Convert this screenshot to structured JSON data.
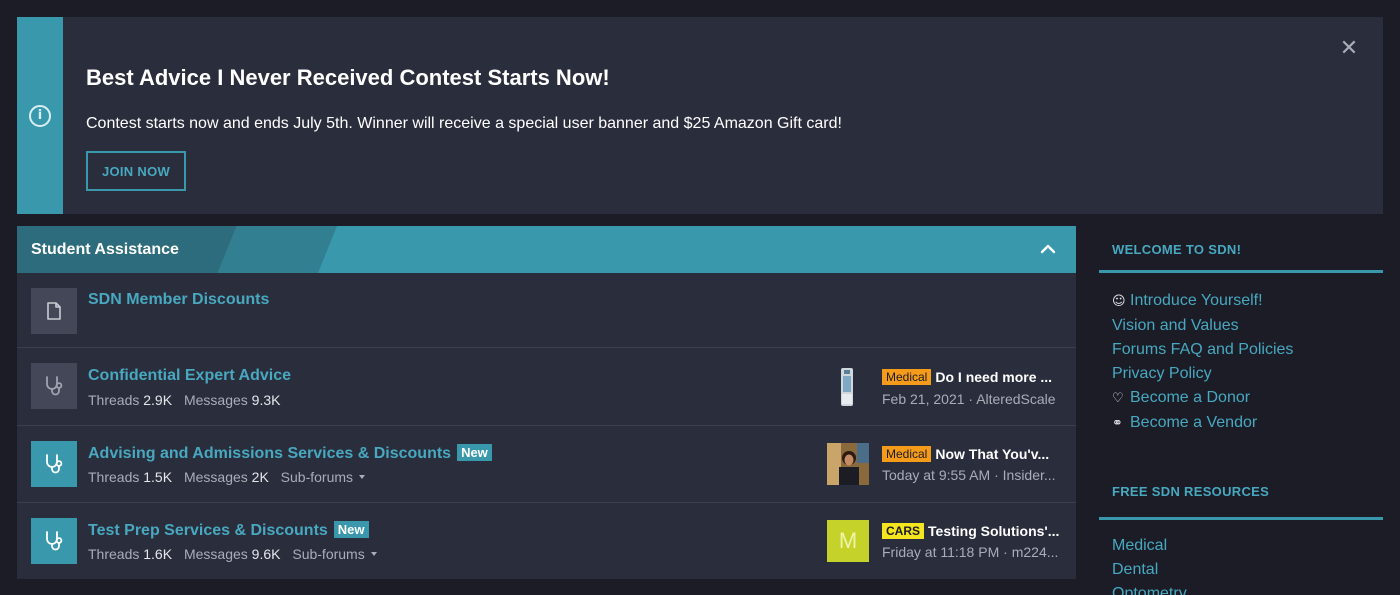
{
  "notice": {
    "title": "Best Advice I Never Received Contest Starts Now!",
    "text": "Contest starts now and ends July 5th. Winner will receive a special user banner and $25 Amazon Gift card!",
    "button": "JOIN NOW",
    "info_icon": "info-icon",
    "close_icon": "close-icon"
  },
  "forum": {
    "category": "Student Assistance",
    "nodes": [
      {
        "title": "SDN Member Discounts",
        "icon": "document-icon"
      },
      {
        "title": "Confidential Expert Advice",
        "icon": "stethoscope-icon",
        "threads_label": "Threads",
        "threads": "2.9K",
        "messages_label": "Messages",
        "messages": "9.3K",
        "last": {
          "prefix": "Medical",
          "title": "Do I need more ...",
          "date": "Feb 21, 2021",
          "user": "AlteredScale"
        }
      },
      {
        "title": "Advising and Admissions Services & Discounts",
        "badge": "New",
        "icon": "stethoscope-icon",
        "threads_label": "Threads",
        "threads": "1.5K",
        "messages_label": "Messages",
        "messages": "2K",
        "subforums": "Sub-forums",
        "last": {
          "prefix": "Medical",
          "title": "Now That You'v...",
          "date": "Today at 9:55 AM",
          "user": "Insider..."
        }
      },
      {
        "title": "Test Prep Services & Discounts",
        "badge": "New",
        "icon": "stethoscope-icon",
        "threads_label": "Threads",
        "threads": "1.6K",
        "messages_label": "Messages",
        "messages": "9.6K",
        "subforums": "Sub-forums",
        "last": {
          "prefix": "CARS",
          "title": "Testing Solutions'...",
          "date": "Friday at 11:18 PM",
          "user": "m224...",
          "avatar_letter": "M"
        }
      }
    ]
  },
  "sidebar": {
    "welcome_title": "WELCOME TO SDN!",
    "welcome_links": [
      {
        "label": "Introduce Yourself!",
        "icon": "smile-icon"
      },
      {
        "label": "Vision and Values"
      },
      {
        "label": "Forums FAQ and Policies"
      },
      {
        "label": "Privacy Policy"
      },
      {
        "label": "Become a Donor",
        "icon": "heart-icon"
      },
      {
        "label": "Become a Vendor",
        "icon": "handshake-icon"
      }
    ],
    "resources_title": "FREE SDN RESOURCES",
    "resources_links": [
      {
        "label": "Medical"
      },
      {
        "label": "Dental"
      },
      {
        "label": "Optometry"
      }
    ]
  },
  "colors": {
    "accent": "#3a98ad",
    "link": "#47a8c0",
    "panel": "#2a2d3b",
    "background": "#1b1c26",
    "medical_prefix": "#f59b1a",
    "cars_prefix": "#f5e51e"
  }
}
